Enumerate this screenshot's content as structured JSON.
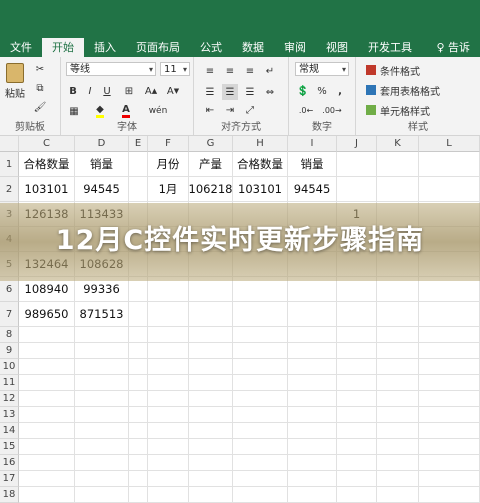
{
  "ribbon_tabs": [
    "文件",
    "开始",
    "插入",
    "页面布局",
    "公式",
    "数据",
    "审阅",
    "视图",
    "开发工具"
  ],
  "active_tab": "开始",
  "tell_me": "♀ 告诉",
  "clipboard": {
    "paste": "粘贴",
    "label": "剪贴板"
  },
  "font": {
    "name": "等线",
    "size": "11",
    "label": "字体",
    "bold": "B",
    "italic": "I",
    "underline": "U",
    "wen": "wén"
  },
  "alignment": {
    "label": "对齐方式"
  },
  "number": {
    "format": "常规",
    "label": "数字",
    "percent": "%",
    "comma": ","
  },
  "styles": {
    "conditional": "条件格式",
    "table": "套用表格格式",
    "cell": "单元格样式",
    "label": "样式"
  },
  "columns": [
    "C",
    "D",
    "E",
    "F",
    "G",
    "H",
    "I",
    "J",
    "K",
    "L"
  ],
  "rows": [
    "1",
    "2",
    "3",
    "4",
    "5",
    "6",
    "7",
    "8",
    "9",
    "10",
    "11",
    "12",
    "13",
    "14",
    "15",
    "16",
    "17",
    "18"
  ],
  "cells": {
    "r1": [
      "合格数量",
      "销量",
      "",
      "月份",
      "产量",
      "合格数量",
      "销量",
      "",
      "",
      ""
    ],
    "r2": [
      "103101",
      "94545",
      "",
      "1月",
      "106218",
      "103101",
      "94545",
      "",
      "",
      ""
    ],
    "r3": [
      "126138",
      "113433",
      "",
      "",
      "",
      "",
      "",
      "1",
      "",
      ""
    ],
    "r4": [
      "",
      "",
      "",
      "",
      "",
      "",
      "",
      "",
      "",
      ""
    ],
    "r5": [
      "132464",
      "108628",
      "",
      "",
      "",
      "",
      "",
      "",
      "",
      ""
    ],
    "r6": [
      "108940",
      "99336",
      "",
      "",
      "",
      "",
      "",
      "",
      "",
      ""
    ],
    "r7": [
      "989650",
      "871513",
      "",
      "",
      "",
      "",
      "",
      "",
      "",
      ""
    ]
  },
  "banner": "12月C控件实时更新步骤指南",
  "colors": {
    "excel_green": "#217346",
    "overlay": "#a8946a",
    "banner_text": "#ffffff"
  }
}
